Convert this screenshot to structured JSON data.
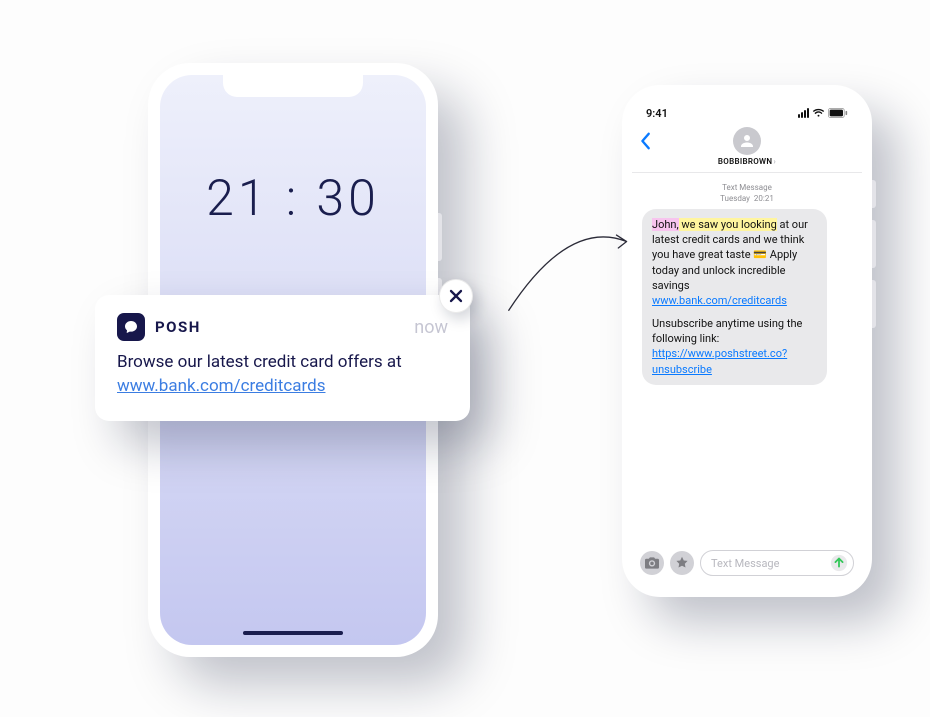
{
  "left_phone": {
    "clock": "21 : 30"
  },
  "notification": {
    "brand": "POSH",
    "time_label": "now",
    "body_text": "Browse our latest credit card offers at ",
    "link_text": "www.bank.com/creditcards"
  },
  "right_phone": {
    "status_time": "9:41",
    "contact_name": "BOBBIBROWN",
    "thread_label": "Text Message",
    "thread_time_day": "Tuesday",
    "thread_time_clock": "20:21",
    "bubble": {
      "hl_name": "John,",
      "hl_phrase": " we saw you looking",
      "rest_1": " at our latest credit cards and we think you have great taste ",
      "emoji": "💳",
      "rest_2": " Apply today and unlock incredible savings",
      "link1": "www.bank.com/creditcards",
      "unsub_text": "Unsubscribe anytime using the following link:",
      "link2": "https://www.poshstreet.co?unsubscribe"
    },
    "input_placeholder": "Text Message"
  }
}
